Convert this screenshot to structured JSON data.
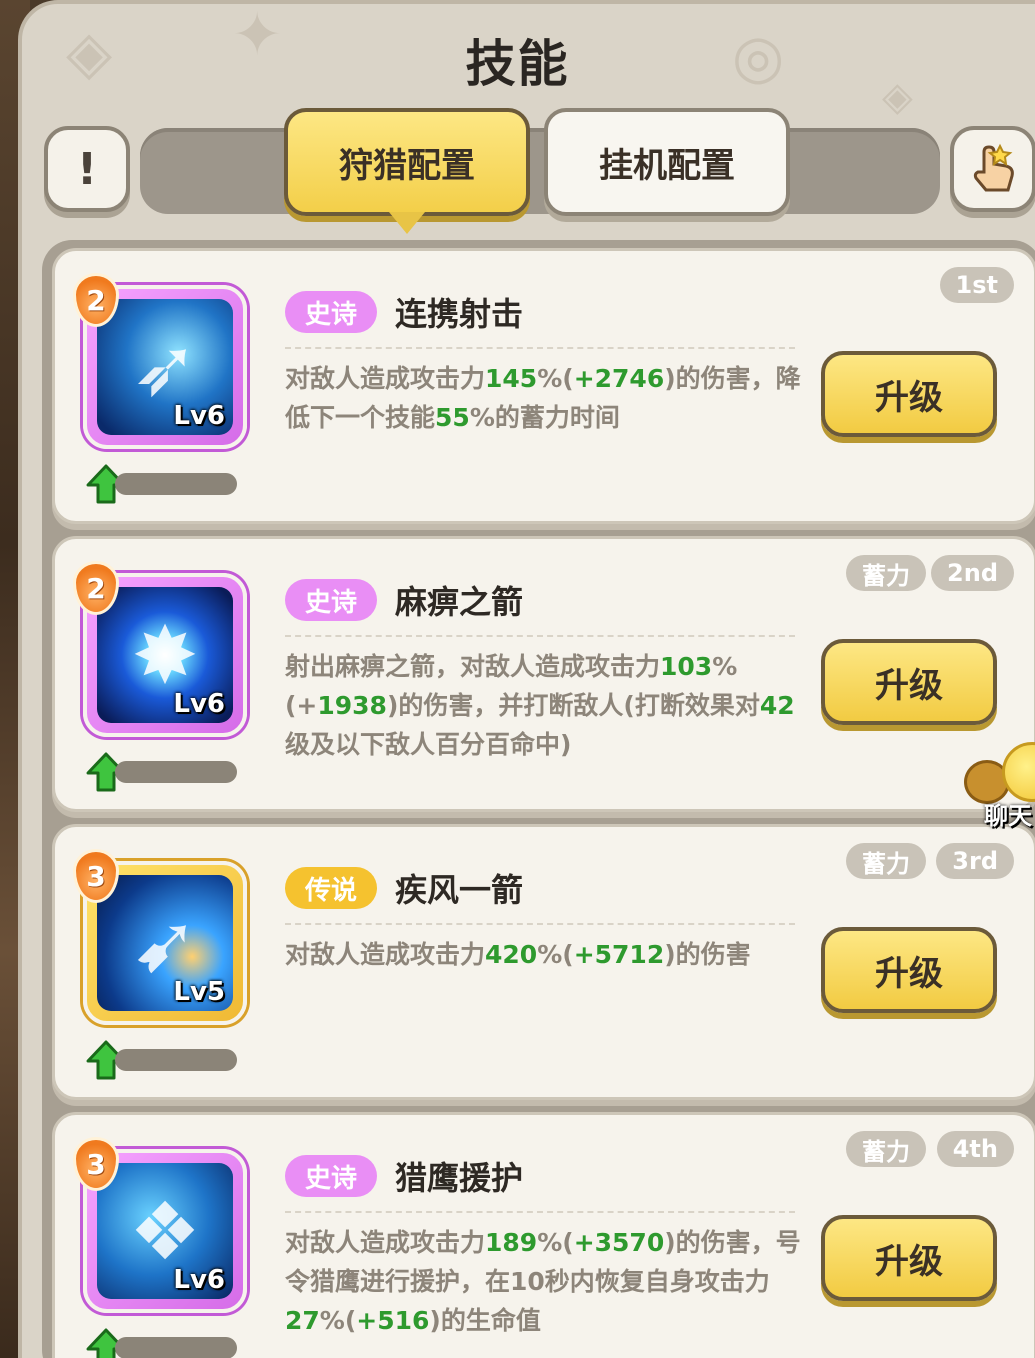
{
  "title": "技能",
  "info_icon": "exclamation-icon",
  "hand_icon": "pointing-hand-icon",
  "tabs": [
    {
      "label": "狩猎配置",
      "active": true
    },
    {
      "label": "挂机配置",
      "active": false
    }
  ],
  "upgrade_label": "升级",
  "chat_label": "聊天",
  "skills": [
    {
      "rarity": "史诗",
      "rarity_type": "epic",
      "name": "连携射击",
      "level": "Lv6",
      "star": "2",
      "order": "1st",
      "charge": "",
      "desc": [
        {
          "t": "对敌人造成攻击力"
        },
        {
          "t": "145",
          "g": true
        },
        {
          "t": "%("
        },
        {
          "t": "+2746",
          "g": true
        },
        {
          "t": ")的伤害，降低下一个技能"
        },
        {
          "t": "55",
          "g": true
        },
        {
          "t": "%的蓄力时间"
        }
      ]
    },
    {
      "rarity": "史诗",
      "rarity_type": "epic",
      "name": "麻痹之箭",
      "level": "Lv6",
      "star": "2",
      "order": "2nd",
      "charge": "蓄力",
      "desc": [
        {
          "t": "射出麻痹之箭，对敌人造成攻击力"
        },
        {
          "t": "103",
          "g": true
        },
        {
          "t": "%(+"
        },
        {
          "t": "1938",
          "g": true
        },
        {
          "t": ")的伤害，并打断敌人(打断效果对"
        },
        {
          "t": "42",
          "g": true
        },
        {
          "t": "级及以下敌人百分百命中)"
        }
      ]
    },
    {
      "rarity": "传说",
      "rarity_type": "legend",
      "name": "疾风一箭",
      "level": "Lv5",
      "star": "3",
      "order": "3rd",
      "charge": "蓄力",
      "desc": [
        {
          "t": "对敌人造成攻击力"
        },
        {
          "t": "420",
          "g": true
        },
        {
          "t": "%("
        },
        {
          "t": "+5712",
          "g": true
        },
        {
          "t": ")的伤害"
        }
      ]
    },
    {
      "rarity": "史诗",
      "rarity_type": "epic",
      "name": "猎鹰援护",
      "level": "Lv6",
      "star": "3",
      "order": "4th",
      "charge": "蓄力",
      "desc": [
        {
          "t": "对敌人造成攻击力"
        },
        {
          "t": "189",
          "g": true
        },
        {
          "t": "%("
        },
        {
          "t": "+3570",
          "g": true
        },
        {
          "t": ")的伤害，号令猎鹰进行援护，在10秒内恢复自身攻击力"
        },
        {
          "t": "27",
          "g": true
        },
        {
          "t": "%("
        },
        {
          "t": "+516",
          "g": true
        },
        {
          "t": ")的生命值"
        }
      ]
    }
  ]
}
